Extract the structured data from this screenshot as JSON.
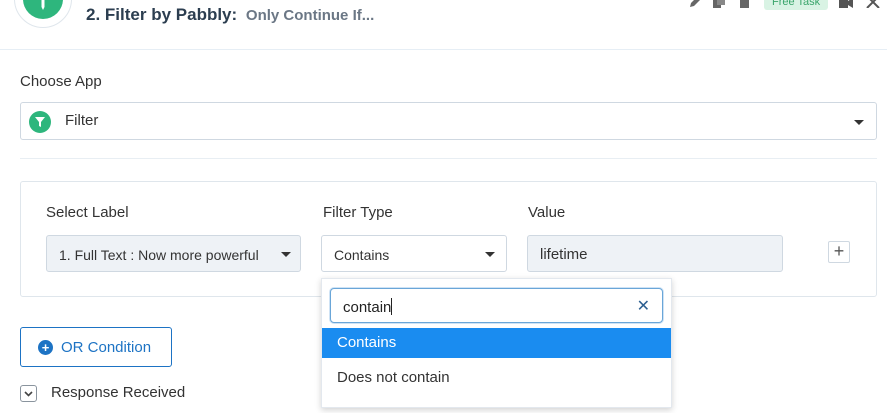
{
  "header": {
    "step_number": "2.",
    "app_name": "Filter by Pabbly:",
    "action": "Only Continue If...",
    "badge": "Free Task",
    "icons": [
      "pencil-icon",
      "copy-icon",
      "trash-icon",
      "video-icon",
      "close-icon"
    ]
  },
  "choose_app": {
    "label": "Choose App",
    "selected": "Filter",
    "icon": "filter-icon",
    "accent": "#2eb67d"
  },
  "condition": {
    "select_label": {
      "label": "Select Label",
      "value": "1. Full Text : Now more powerful"
    },
    "filter_type": {
      "label": "Filter Type",
      "value": "Contains"
    },
    "value_field": {
      "label": "Value",
      "value": "lifetime"
    },
    "add_label": "+"
  },
  "dropdown": {
    "search_value": "contain",
    "options": [
      {
        "label": "Contains",
        "selected": true
      },
      {
        "label": "Does not contain",
        "selected": false
      }
    ],
    "highlight_color": "#1a8cf0"
  },
  "or_condition": {
    "label": "OR Condition",
    "color": "#1d73c4"
  },
  "response": {
    "label": "Response Received"
  }
}
